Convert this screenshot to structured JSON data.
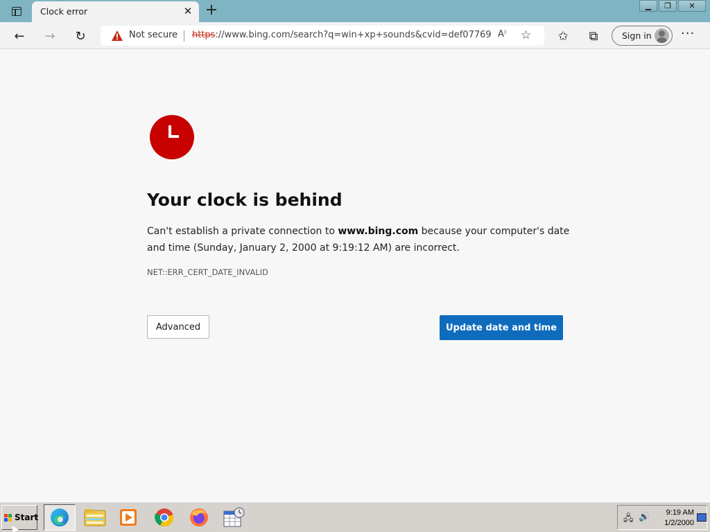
{
  "browser": {
    "tab": {
      "title": "Clock error",
      "close_glyph": "✕"
    },
    "new_tab_glyph": "+",
    "window_controls": {
      "minimize": "▁",
      "restore": "❐",
      "close": "✕"
    },
    "toolbar": {
      "back_glyph": "←",
      "forward_glyph": "→",
      "refresh_glyph": "↻",
      "security_label": "Not secure",
      "url_scheme": "https",
      "url_rest": "://www.bing.com/search?q=win+xp+sounds&cvid=def07769d...",
      "read_aloud_glyph": "A⁾",
      "add_favorite_glyph": "☆",
      "favorites_glyph": "✩",
      "collections_glyph": "⧉",
      "sign_in_label": "Sign in",
      "more_glyph": "···"
    }
  },
  "page": {
    "icon": "clock-icon",
    "accent_color": "#c80000",
    "heading": "Your clock is behind",
    "description": {
      "part1": "Can't establish a private connection to ",
      "domain": "www.bing.com",
      "part2": " because your computer's date and time (Sunday, January 2, 2000 at 9:19:12 AM) are incorrect."
    },
    "error_code": "NET::ERR_CERT_DATE_INVALID",
    "advanced_button": "Advanced",
    "update_button": "Update date and time",
    "button_color": "#0f6cbd"
  },
  "taskbar": {
    "start_label": "Start",
    "apps": [
      {
        "name": "edge-icon",
        "active": true
      },
      {
        "name": "explorer-icon",
        "active": false
      },
      {
        "name": "media-player-icon",
        "active": false
      },
      {
        "name": "chrome-icon",
        "active": false
      },
      {
        "name": "firefox-icon",
        "active": false
      },
      {
        "name": "calendar-clock-icon",
        "active": false
      }
    ],
    "clock_time": "9:19 AM",
    "clock_date": "1/2/2000"
  }
}
